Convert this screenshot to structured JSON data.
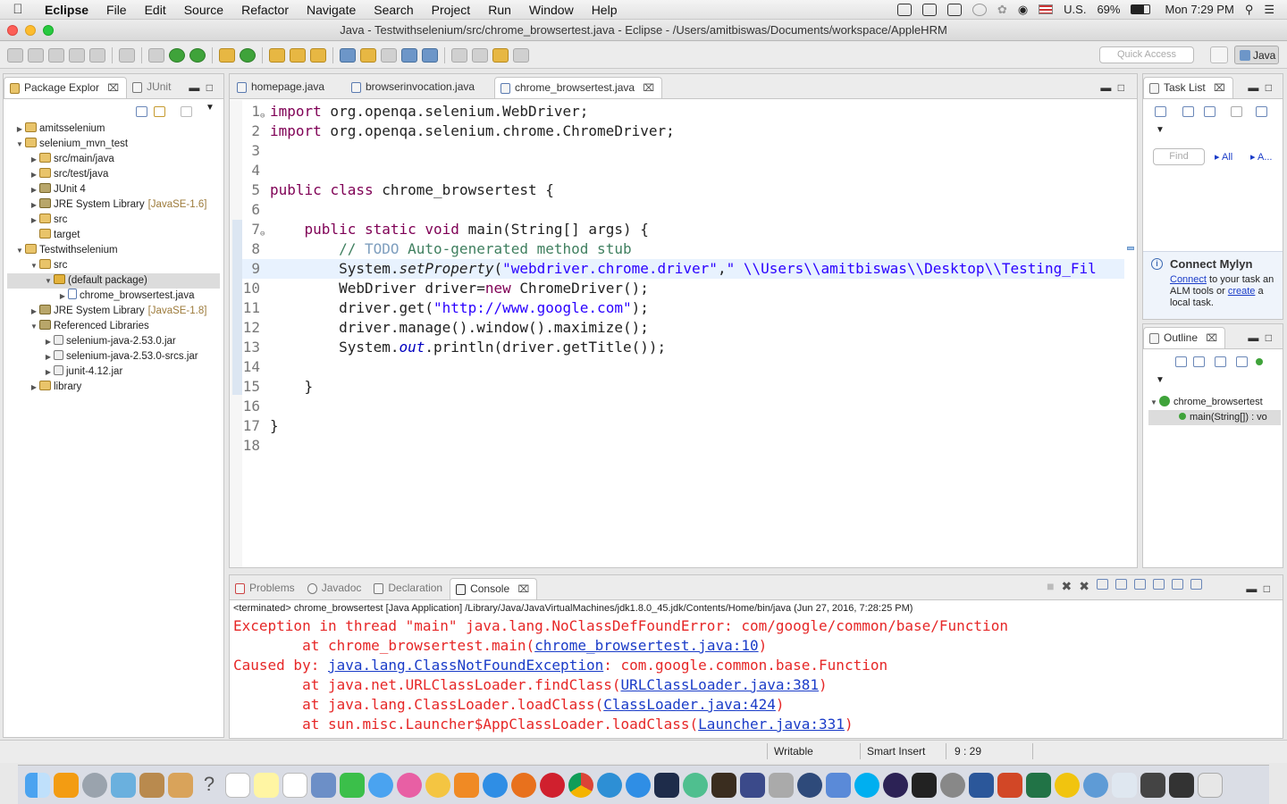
{
  "menubar": {
    "app": "Eclipse",
    "items": [
      "File",
      "Edit",
      "Source",
      "Refactor",
      "Navigate",
      "Search",
      "Project",
      "Run",
      "Window",
      "Help"
    ],
    "input_source": "U.S.",
    "battery": "69%",
    "clock": "Mon 7:29 PM"
  },
  "window": {
    "title": "Java - Testwithselenium/src/chrome_browsertest.java - Eclipse - /Users/amitbiswas/Documents/workspace/AppleHRM"
  },
  "toolbar": {
    "quick_access_placeholder": "Quick Access",
    "perspective": "Java"
  },
  "package_explorer": {
    "tabs": [
      {
        "label": "Package Explor",
        "active": true
      },
      {
        "label": "JUnit",
        "active": false
      }
    ],
    "tree": [
      {
        "label": "amitsselenium",
        "depth": 0,
        "arrow": "closed",
        "icon": "proj"
      },
      {
        "label": "selenium_mvn_test",
        "depth": 0,
        "arrow": "open",
        "icon": "proj"
      },
      {
        "label": "src/main/java",
        "depth": 1,
        "arrow": "closed",
        "icon": "folder"
      },
      {
        "label": "src/test/java",
        "depth": 1,
        "arrow": "closed",
        "icon": "folder"
      },
      {
        "label": "JUnit 4",
        "depth": 1,
        "arrow": "closed",
        "icon": "lib"
      },
      {
        "label": "JRE System Library",
        "deco": "[JavaSE-1.6]",
        "depth": 1,
        "arrow": "closed",
        "icon": "lib"
      },
      {
        "label": "src",
        "depth": 1,
        "arrow": "closed",
        "icon": "folder"
      },
      {
        "label": "target",
        "depth": 1,
        "arrow": "none",
        "icon": "folder"
      },
      {
        "label": "Testwithselenium",
        "depth": 0,
        "arrow": "open",
        "icon": "proj"
      },
      {
        "label": "src",
        "depth": 1,
        "arrow": "open",
        "icon": "folder"
      },
      {
        "label": "(default package)",
        "depth": 2,
        "arrow": "open",
        "icon": "pkg",
        "selected": true
      },
      {
        "label": "chrome_browsertest.java",
        "depth": 3,
        "arrow": "closed",
        "icon": "file"
      },
      {
        "label": "JRE System Library",
        "deco": "[JavaSE-1.8]",
        "depth": 1,
        "arrow": "closed",
        "icon": "lib"
      },
      {
        "label": "Referenced Libraries",
        "depth": 1,
        "arrow": "open",
        "icon": "lib"
      },
      {
        "label": "selenium-java-2.53.0.jar",
        "depth": 2,
        "arrow": "closed",
        "icon": "jar"
      },
      {
        "label": "selenium-java-2.53.0-srcs.jar",
        "depth": 2,
        "arrow": "closed",
        "icon": "jar"
      },
      {
        "label": "junit-4.12.jar",
        "depth": 2,
        "arrow": "closed",
        "icon": "jar"
      },
      {
        "label": "library",
        "depth": 1,
        "arrow": "closed",
        "icon": "folder"
      }
    ]
  },
  "editor": {
    "tabs": [
      {
        "label": "homepage.java",
        "active": false
      },
      {
        "label": "browserinvocation.java",
        "active": false
      },
      {
        "label": "chrome_browsertest.java",
        "active": true
      }
    ],
    "lines": [
      "1",
      "2",
      "3",
      "4",
      "5",
      "6",
      "7",
      "8",
      "9",
      "10",
      "11",
      "12",
      "13",
      "14",
      "15",
      "16",
      "17",
      "18"
    ],
    "code": {
      "l1_kw": "import",
      "l1_rest": " org.openqa.selenium.WebDriver;",
      "l2_kw": "import",
      "l2_rest": " org.openqa.selenium.chrome.ChromeDriver;",
      "l5_kw1": "public",
      "l5_kw2": "class",
      "l5_rest": " chrome_browsertest {",
      "l7_kw1": "public",
      "l7_kw2": "static",
      "l7_kw3": "void",
      "l7_rest": " main(String[] args) {",
      "l8_cmt": "// ",
      "l8_todo": "TODO",
      "l8_cmt2": " Auto-generated method stub",
      "l9_a": "System.",
      "l9_m": "setProperty",
      "l9_b": "(",
      "l9_s1": "\"webdriver.chrome.driver\"",
      "l9_c": ",",
      "l9_s2": "\" \\\\Users\\\\amitbiswas\\\\Desktop\\\\Testing_Fil",
      "l10_a": "WebDriver driver=",
      "l10_kw": "new",
      "l10_b": " ChromeDriver();",
      "l11_a": "driver.get(",
      "l11_s": "\"http://www.google.com\"",
      "l11_b": ");",
      "l12": "driver.manage().window().maximize();",
      "l13_a": "System.",
      "l13_f": "out",
      "l13_b": ".println(driver.getTitle());",
      "l15": "}",
      "l17": "}"
    }
  },
  "task_list": {
    "tab": "Task List",
    "find_placeholder": "Find",
    "filter_all": "All",
    "filter_a": "A...",
    "mylyn": {
      "title": "Connect Mylyn",
      "connect_link": "Connect",
      "text1": " to your task an",
      "text2": "ALM tools or ",
      "create_link": "create",
      "text3": " a",
      "text4": "local task."
    }
  },
  "outline": {
    "tab": "Outline",
    "class_node": "chrome_browsertest",
    "method_node": "main(String[]) : vo"
  },
  "console": {
    "tabs": [
      {
        "label": "Problems",
        "active": false
      },
      {
        "label": "Javadoc",
        "active": false
      },
      {
        "label": "Declaration",
        "active": false
      },
      {
        "label": "Console",
        "active": true
      }
    ],
    "header": "<terminated> chrome_browsertest [Java Application] /Library/Java/JavaVirtualMachines/jdk1.8.0_45.jdk/Contents/Home/bin/java (Jun 27, 2016, 7:28:25 PM)",
    "out": {
      "l1": "Exception in thread \"main\" java.lang.NoClassDefFoundError: com/google/common/base/Function",
      "l2_a": "\tat chrome_browsertest.main(",
      "l2_link": "chrome_browsertest.java:10",
      "l2_b": ")",
      "l3_a": "Caused by: ",
      "l3_link": "java.lang.ClassNotFoundException",
      "l3_b": ": com.google.common.base.Function",
      "l4_a": "\tat java.net.URLClassLoader.findClass(",
      "l4_link": "URLClassLoader.java:381",
      "l4_b": ")",
      "l5_a": "\tat java.lang.ClassLoader.loadClass(",
      "l5_link": "ClassLoader.java:424",
      "l5_b": ")",
      "l6_a": "\tat sun.misc.Launcher$AppClassLoader.loadClass(",
      "l6_link": "Launcher.java:331",
      "l6_b": ")"
    }
  },
  "statusbar": {
    "writable": "Writable",
    "insert_mode": "Smart Insert",
    "position": "9 : 29"
  },
  "colors": {
    "keyword": "#7f0055",
    "string": "#2a00ff",
    "comment": "#3f7f5f",
    "error": "#e62727",
    "link": "#1a3cc8"
  }
}
